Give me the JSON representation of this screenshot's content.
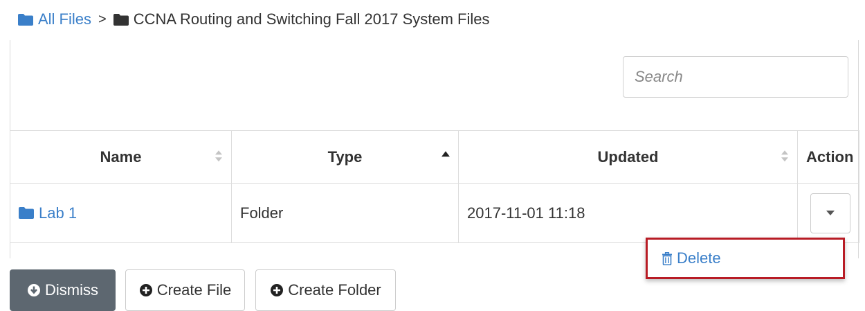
{
  "breadcrumb": {
    "root_label": "All Files",
    "separator": ">",
    "current_label": "CCNA Routing and Switching Fall 2017 System Files"
  },
  "search": {
    "placeholder": "Search",
    "value": ""
  },
  "table": {
    "columns": [
      "Name",
      "Type",
      "Updated",
      "Action"
    ],
    "sort": {
      "column": "Type",
      "direction": "ascending"
    },
    "rows": [
      {
        "name": "Lab 1",
        "type": "Folder",
        "updated": "2017-11-01 11:18"
      }
    ]
  },
  "action_menu": {
    "items": [
      {
        "label": "Delete",
        "icon": "trash-icon"
      }
    ]
  },
  "buttons": {
    "dismiss": "Dismiss",
    "create_file": "Create File",
    "create_folder": "Create Folder"
  },
  "colors": {
    "link": "#3a7fc9",
    "highlight_border": "#b81c25",
    "dismiss_bg": "#5d6770"
  }
}
